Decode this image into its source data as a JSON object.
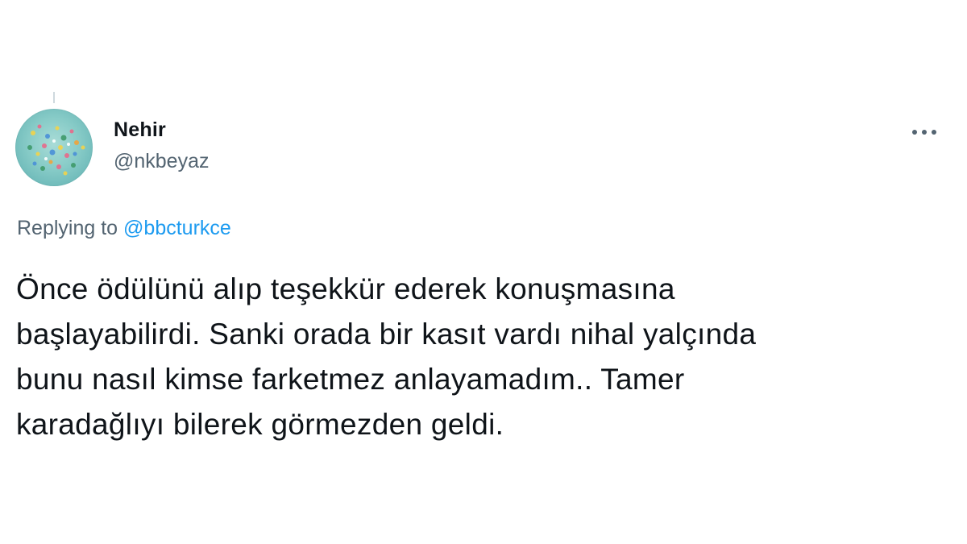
{
  "author": {
    "name": "Nehir",
    "handle": "@nkbeyaz"
  },
  "reply": {
    "prefix": "Replying to",
    "mention": "@bbcturkce"
  },
  "tweet": {
    "lines": [
      "Önce ödülünü alıp teşekkür ederek konuşmasına",
      "başlayabilirdi. Sanki orada bir kasıt vardı nihal yalçında",
      "bunu nasıl kimse farketmez anlayamadım.. Tamer",
      "karadağlıyı bilerek görmezden geldi."
    ]
  },
  "icons": {
    "menu": "more-horizontal-icon"
  },
  "colors": {
    "text": "#0f1419",
    "secondary": "#536471",
    "link": "#1d9bf0"
  }
}
